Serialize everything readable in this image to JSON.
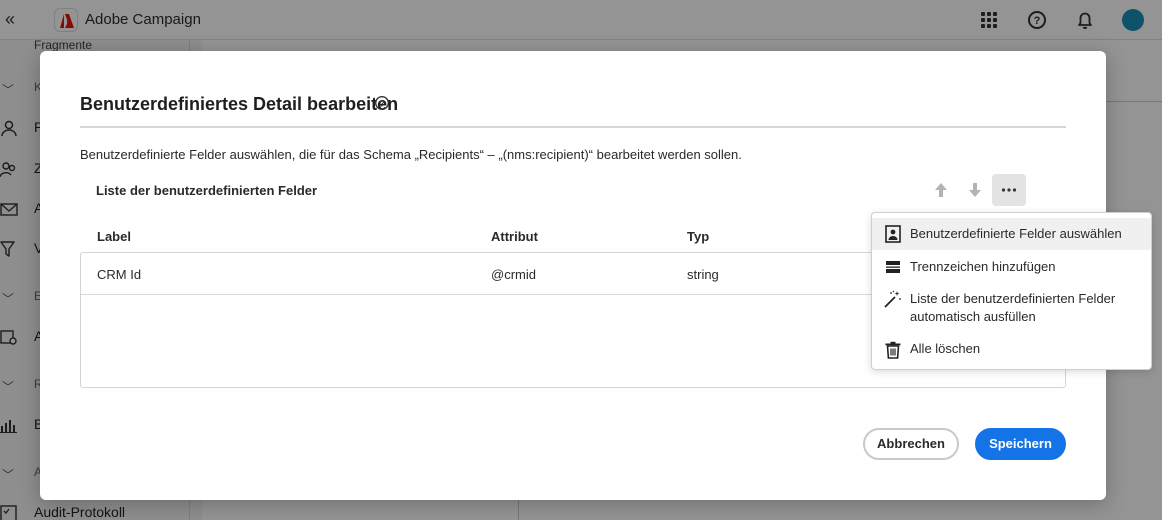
{
  "app": {
    "name": "Adobe Campaign"
  },
  "sidebar": {
    "partial_top_label": "Fragmente",
    "section_1_header": "K",
    "items": [
      {
        "label": "P"
      },
      {
        "label": "Z"
      },
      {
        "label": "A"
      },
      {
        "label": "V"
      }
    ],
    "section_2_header": "E",
    "item_5": "A",
    "section_3_header": "R",
    "item_6": "B",
    "section_4_header": "A",
    "audit": "Audit-Protokoll"
  },
  "dialog": {
    "title": "Benutzerdefiniertes Detail bearbeiten",
    "description": "Benutzerdefinierte Felder auswählen, die für das Schema „Recipients“ – „(nms:recipient)“ bearbeitet werden sollen.",
    "list_title": "Liste der benutzerdefinierten Felder",
    "columns": [
      "Label",
      "Attribut",
      "Typ"
    ],
    "rows": [
      {
        "label": "CRM Id",
        "attribute": "@crmid",
        "type": "string"
      }
    ],
    "cancel_label": "Abbrechen",
    "save_label": "Speichern"
  },
  "menu": {
    "items": [
      {
        "icon": "select-fields-icon",
        "line1": "Benutzerdefinierte Felder auswählen",
        "line2": ""
      },
      {
        "icon": "separator-icon",
        "line1": "Trennzeichen hinzufügen",
        "line2": ""
      },
      {
        "icon": "magic-wand-icon",
        "line1": "Liste der benutzerdefinierten Felder",
        "line2": "automatisch ausfüllen"
      },
      {
        "icon": "trash-icon",
        "line1": "Alle löschen",
        "line2": ""
      }
    ]
  },
  "colors": {
    "accent": "#1473e6",
    "brand": "#eb1000"
  }
}
